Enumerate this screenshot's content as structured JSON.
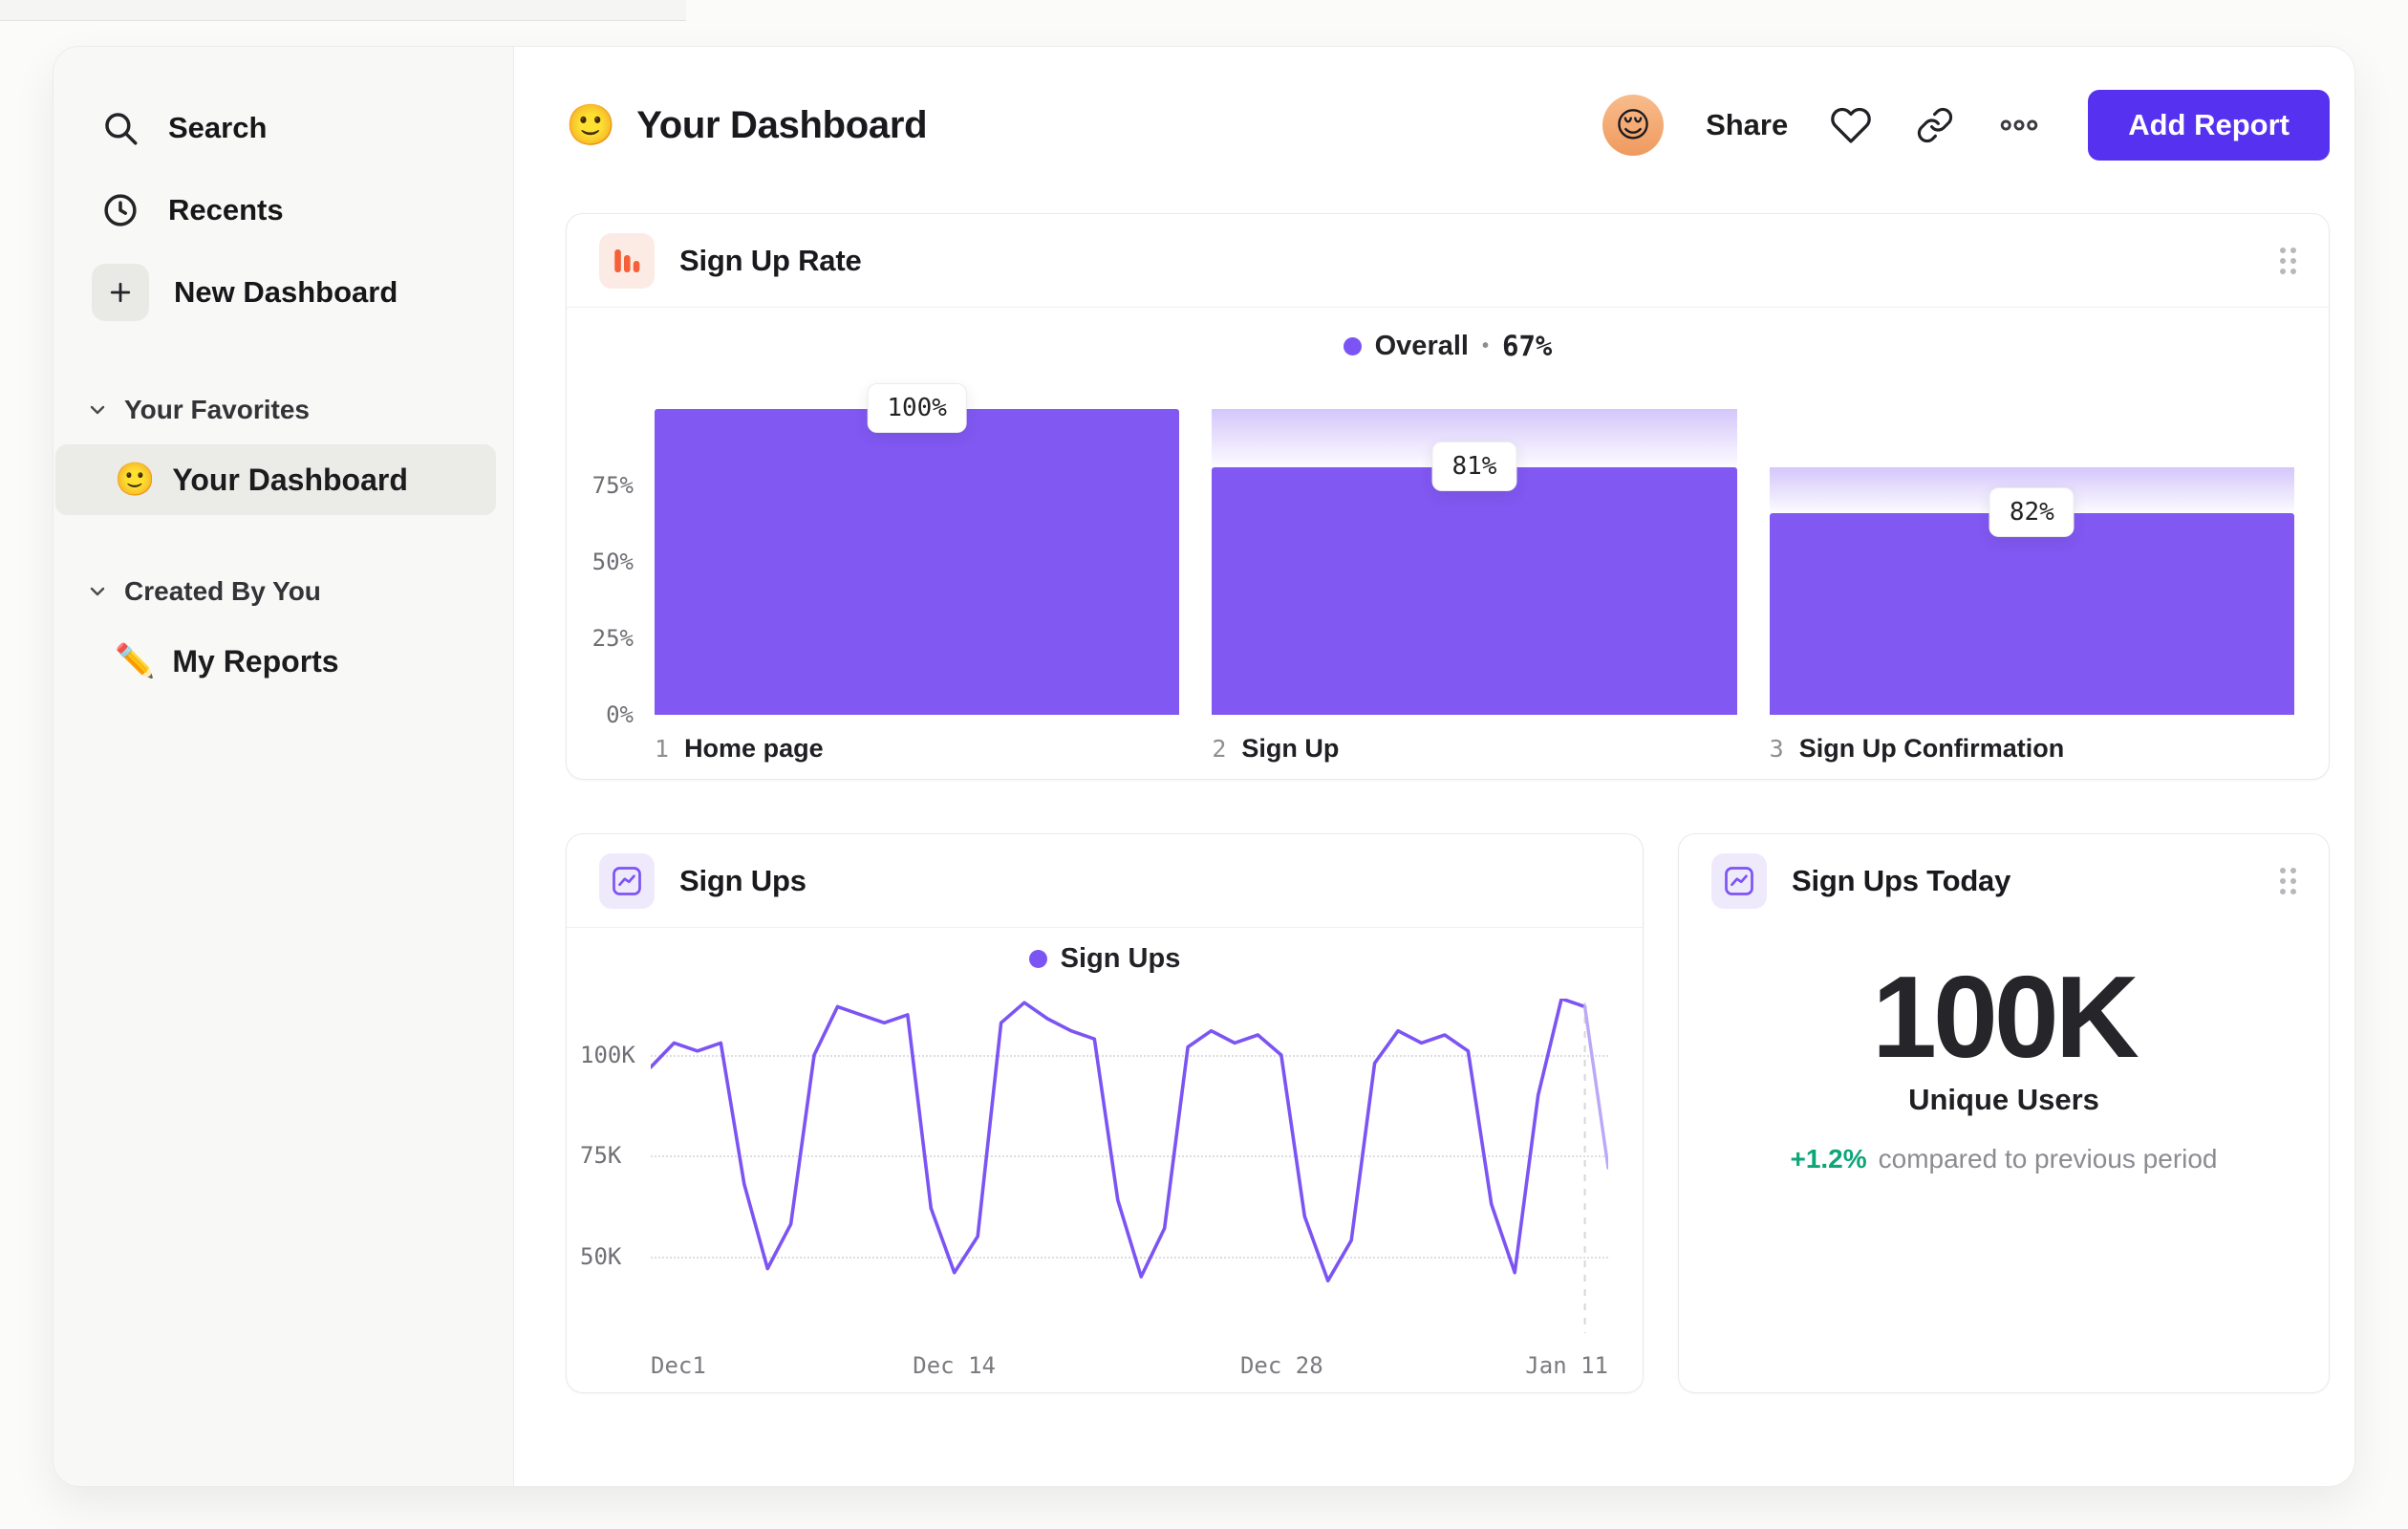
{
  "colors": {
    "accent_purple": "#7C54F3",
    "bar_purple": "#8158F2",
    "tail_purple": "#BBA8F7",
    "button_purple": "#5731F0",
    "icon_orange": "#F4603A",
    "green": "#0CA678"
  },
  "sidebar": {
    "nav": [
      {
        "label": "Search"
      },
      {
        "label": "Recents"
      },
      {
        "label": "New Dashboard"
      }
    ],
    "sections": [
      {
        "title": "Your Favorites",
        "items": [
          {
            "emoji": "🙂",
            "label": "Your Dashboard",
            "selected": true
          }
        ]
      },
      {
        "title": "Created By You",
        "items": [
          {
            "emoji": "✏️",
            "label": "My Reports",
            "selected": false
          }
        ]
      }
    ]
  },
  "header": {
    "emoji": "🙂",
    "title": "Your Dashboard",
    "avatar_emoji": "😌",
    "share": "Share",
    "add_report": "Add Report"
  },
  "funnel_card": {
    "title": "Sign Up Rate",
    "legend_label": "Overall",
    "legend_sep": "•",
    "legend_value": "67%"
  },
  "line_card": {
    "title": "Sign Ups",
    "legend_label": "Sign Ups"
  },
  "kpi_card": {
    "title": "Sign Ups Today",
    "value": "100K",
    "metric": "Unique Users",
    "delta": "+1.2%",
    "delta_note": "compared to previous period"
  },
  "chart_data": [
    {
      "type": "bar",
      "subtype": "funnel",
      "title": "Sign Up Rate",
      "legend": "Overall • 67%",
      "y_ticks": [
        "75%",
        "50%",
        "25%",
        "0%"
      ],
      "y_tick_values": [
        75,
        50,
        25,
        0
      ],
      "ylim": [
        0,
        100
      ],
      "steps": [
        {
          "index": "1",
          "label": "Home page",
          "value_label": "100%",
          "absolute_pct": 100,
          "previous_pct": 100
        },
        {
          "index": "2",
          "label": "Sign Up",
          "value_label": "81%",
          "absolute_pct": 81,
          "previous_pct": 100
        },
        {
          "index": "3",
          "label": "Sign Up Confirmation",
          "value_label": "82%",
          "absolute_pct": 66,
          "previous_pct": 81
        }
      ]
    },
    {
      "type": "line",
      "title": "Sign Ups",
      "legend": "Sign Ups",
      "unit": "K",
      "x_ticks": [
        {
          "label": "Dec1",
          "fraction": 0
        },
        {
          "label": "Dec 14",
          "fraction": 0.317
        },
        {
          "label": "Dec 28",
          "fraction": 0.659
        },
        {
          "label": "Jan 11",
          "fraction": 1
        }
      ],
      "y_ticks": [
        {
          "label": "100K",
          "value": 100
        },
        {
          "label": "75K",
          "value": 75
        },
        {
          "label": "50K",
          "value": 50
        }
      ],
      "ylim": [
        31,
        114
      ],
      "values": [
        97,
        103,
        101,
        103,
        68,
        47,
        58,
        100,
        112,
        110,
        108,
        110,
        62,
        46,
        55,
        108,
        113,
        109,
        106,
        104,
        64,
        45,
        57,
        102,
        106,
        103,
        105,
        100,
        60,
        44,
        54,
        98,
        106,
        103,
        105,
        101,
        63,
        46,
        90,
        114,
        112,
        72
      ]
    },
    {
      "type": "kpi",
      "title": "Sign Ups Today",
      "value": "100K",
      "label": "Unique Users",
      "delta_pct": "+1.2%",
      "comparison": "compared to previous period"
    }
  ]
}
